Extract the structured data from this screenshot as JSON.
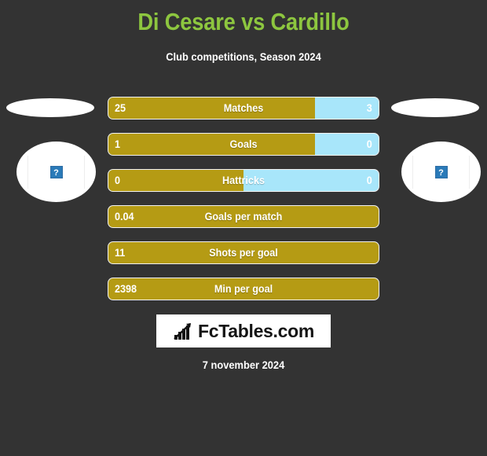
{
  "header": {
    "title": "Di Cesare vs Cardillo",
    "subtitle": "Club competitions, Season 2024",
    "title_color": "#8DC63F"
  },
  "colors": {
    "background": "#333333",
    "home_bar": "#B59B14",
    "away_bar": "#A8E6FA",
    "text": "#FFFFFF"
  },
  "players": {
    "home": {
      "photo_placeholder": "?"
    },
    "away": {
      "photo_placeholder": "?"
    }
  },
  "stats": [
    {
      "label": "Matches",
      "home": "25",
      "away": "3",
      "home_pct": 76.5,
      "has_away": true
    },
    {
      "label": "Goals",
      "home": "1",
      "away": "0",
      "home_pct": 76.5,
      "has_away": true
    },
    {
      "label": "Hattricks",
      "home": "0",
      "away": "0",
      "home_pct": 50.0,
      "has_away": true
    },
    {
      "label": "Goals per match",
      "home": "0.04",
      "away": "",
      "home_pct": 100,
      "has_away": false
    },
    {
      "label": "Shots per goal",
      "home": "11",
      "away": "",
      "home_pct": 100,
      "has_away": false
    },
    {
      "label": "Min per goal",
      "home": "2398",
      "away": "",
      "home_pct": 100,
      "has_away": false
    }
  ],
  "logo": {
    "text": "FcTables.com",
    "icon": "bar-chart-icon"
  },
  "footer": {
    "date": "7 november 2024"
  },
  "chart_data": {
    "type": "bar",
    "title": "Di Cesare vs Cardillo",
    "subtitle": "Club competitions, Season 2024",
    "categories": [
      "Matches",
      "Goals",
      "Hattricks",
      "Goals per match",
      "Shots per goal",
      "Min per goal"
    ],
    "series": [
      {
        "name": "Di Cesare",
        "values": [
          25,
          1,
          0,
          0.04,
          11,
          2398
        ],
        "color": "#B59B14"
      },
      {
        "name": "Cardillo",
        "values": [
          3,
          0,
          0,
          null,
          null,
          null
        ],
        "color": "#A8E6FA"
      }
    ],
    "orientation": "horizontal",
    "stacked": true,
    "grid": false,
    "legend": "none"
  }
}
